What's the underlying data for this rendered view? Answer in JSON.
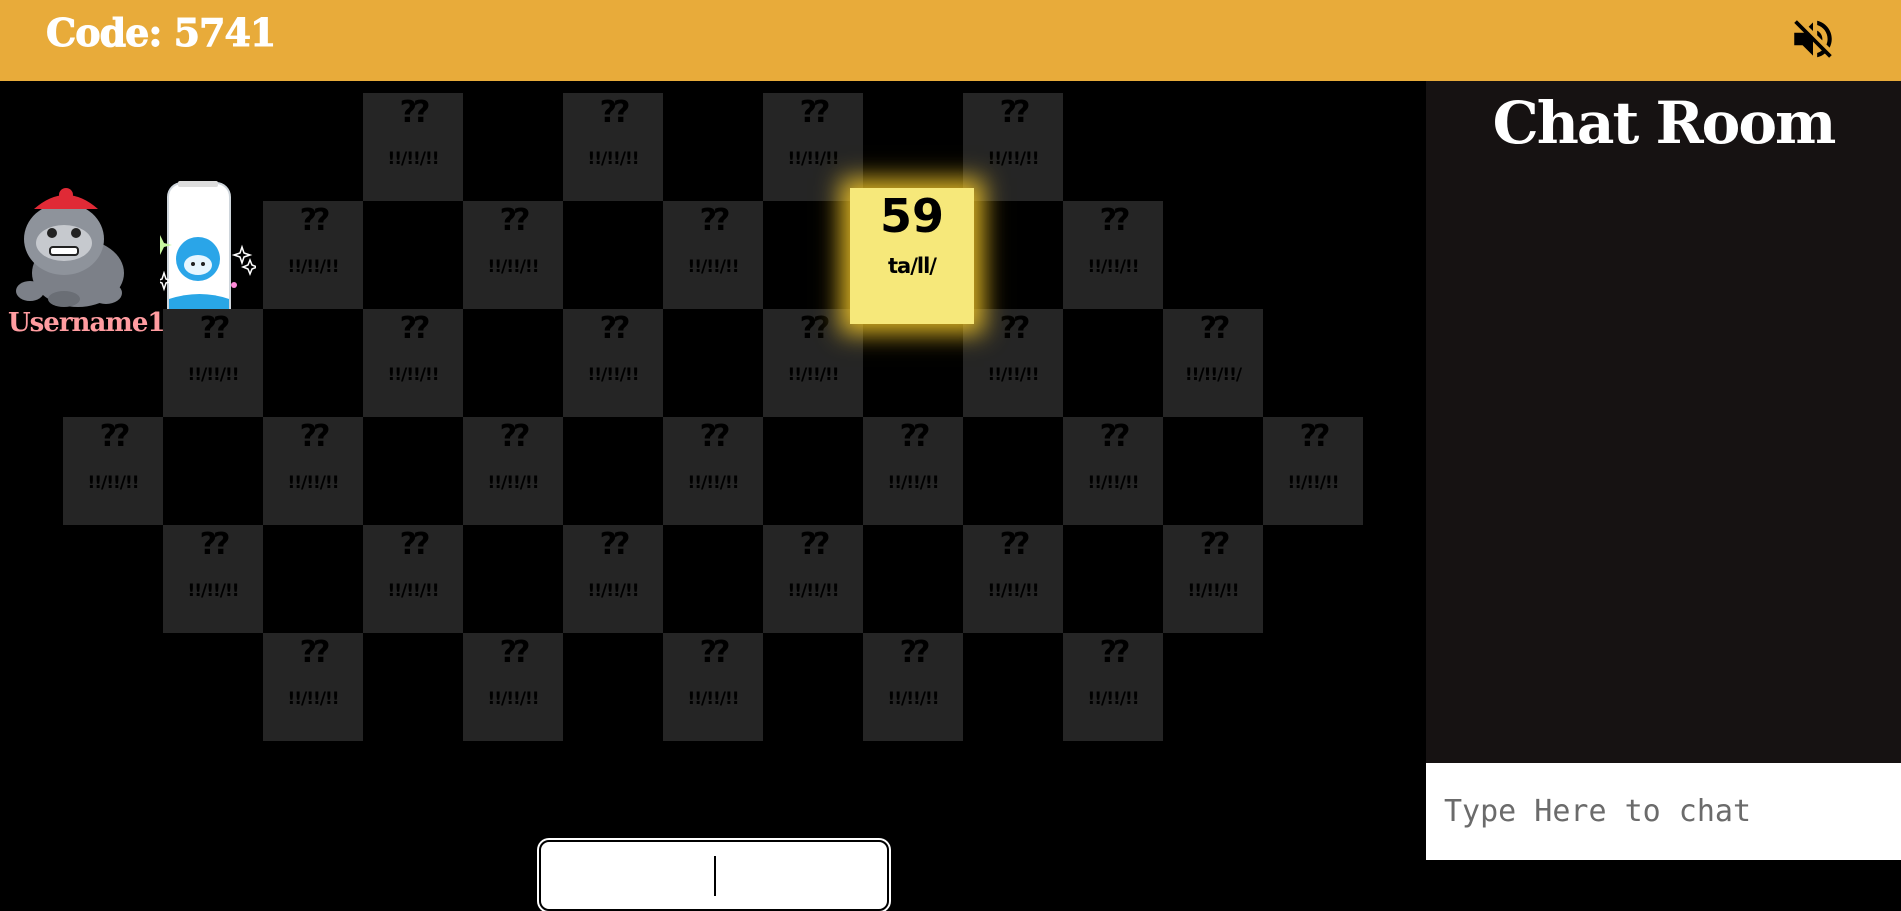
{
  "header": {
    "room_code": "Code: 5741",
    "mute_icon": "speaker-muted-icon"
  },
  "player": {
    "name": "Username1",
    "avatar_icon": "gorilla-avatar",
    "meter_icon": "water-bottle-slime-icon"
  },
  "board": {
    "tile_question": "??",
    "tile_subtitle": "!!/!!/!!",
    "tile_subtitle_alt": "!!/!!/!!/",
    "active_tile": {
      "number": "59",
      "subtitle": "ta/ll/"
    }
  },
  "answer": {
    "value": ""
  },
  "chat": {
    "title": "Chat Room",
    "placeholder": "Type Here to chat"
  },
  "colors": {
    "header": "#e8ab3a",
    "tile": "#252525",
    "active_tile": "#f6e87a",
    "chat_panel": "#161212",
    "username": "#ff9ca0"
  }
}
